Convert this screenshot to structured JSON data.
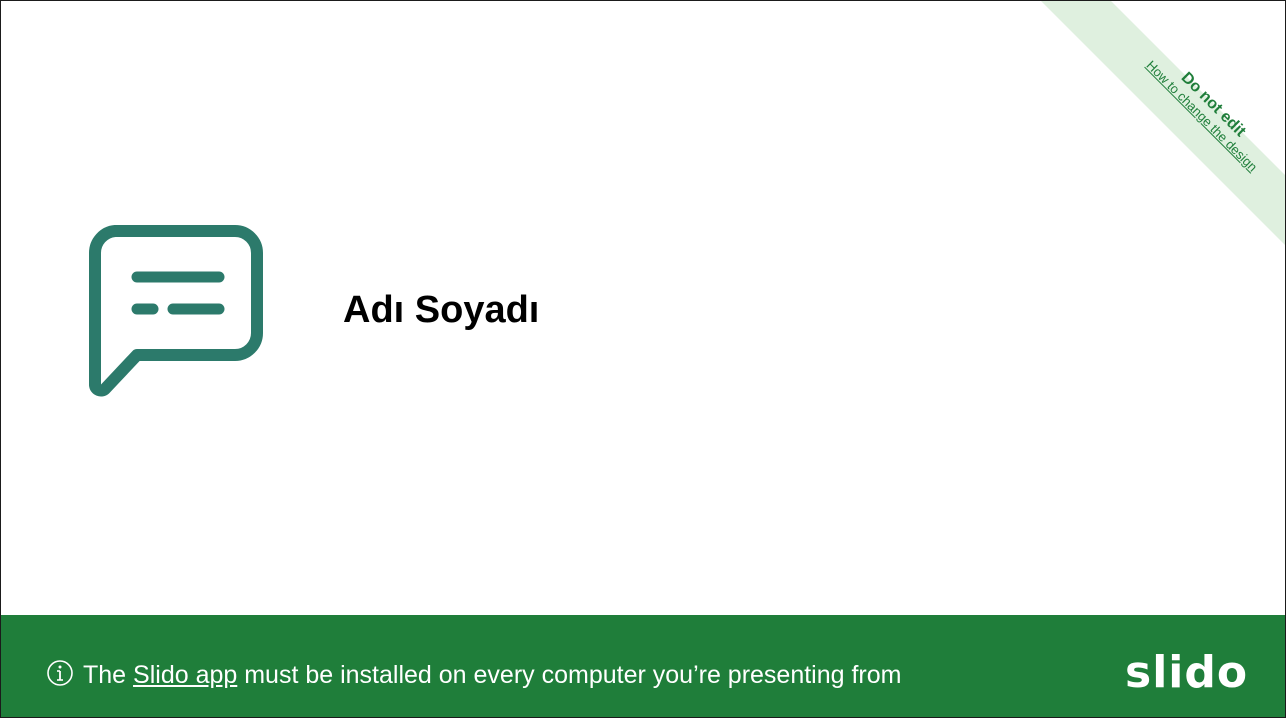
{
  "ribbon": {
    "title": "Do not edit",
    "link": "How to change the design",
    "color": "#1f7e3a",
    "fill": "#dff0df"
  },
  "slide": {
    "title": "Adı Soyadı",
    "icon": "chat-bubble-icon",
    "icon_color": "#2c7a6b"
  },
  "footer": {
    "info_icon": "info-icon",
    "text_prefix": "The ",
    "link_text": "Slido app",
    "text_suffix": " must be installed on every computer you’re presenting from",
    "logo": "slido",
    "background": "#1f7e3a"
  }
}
